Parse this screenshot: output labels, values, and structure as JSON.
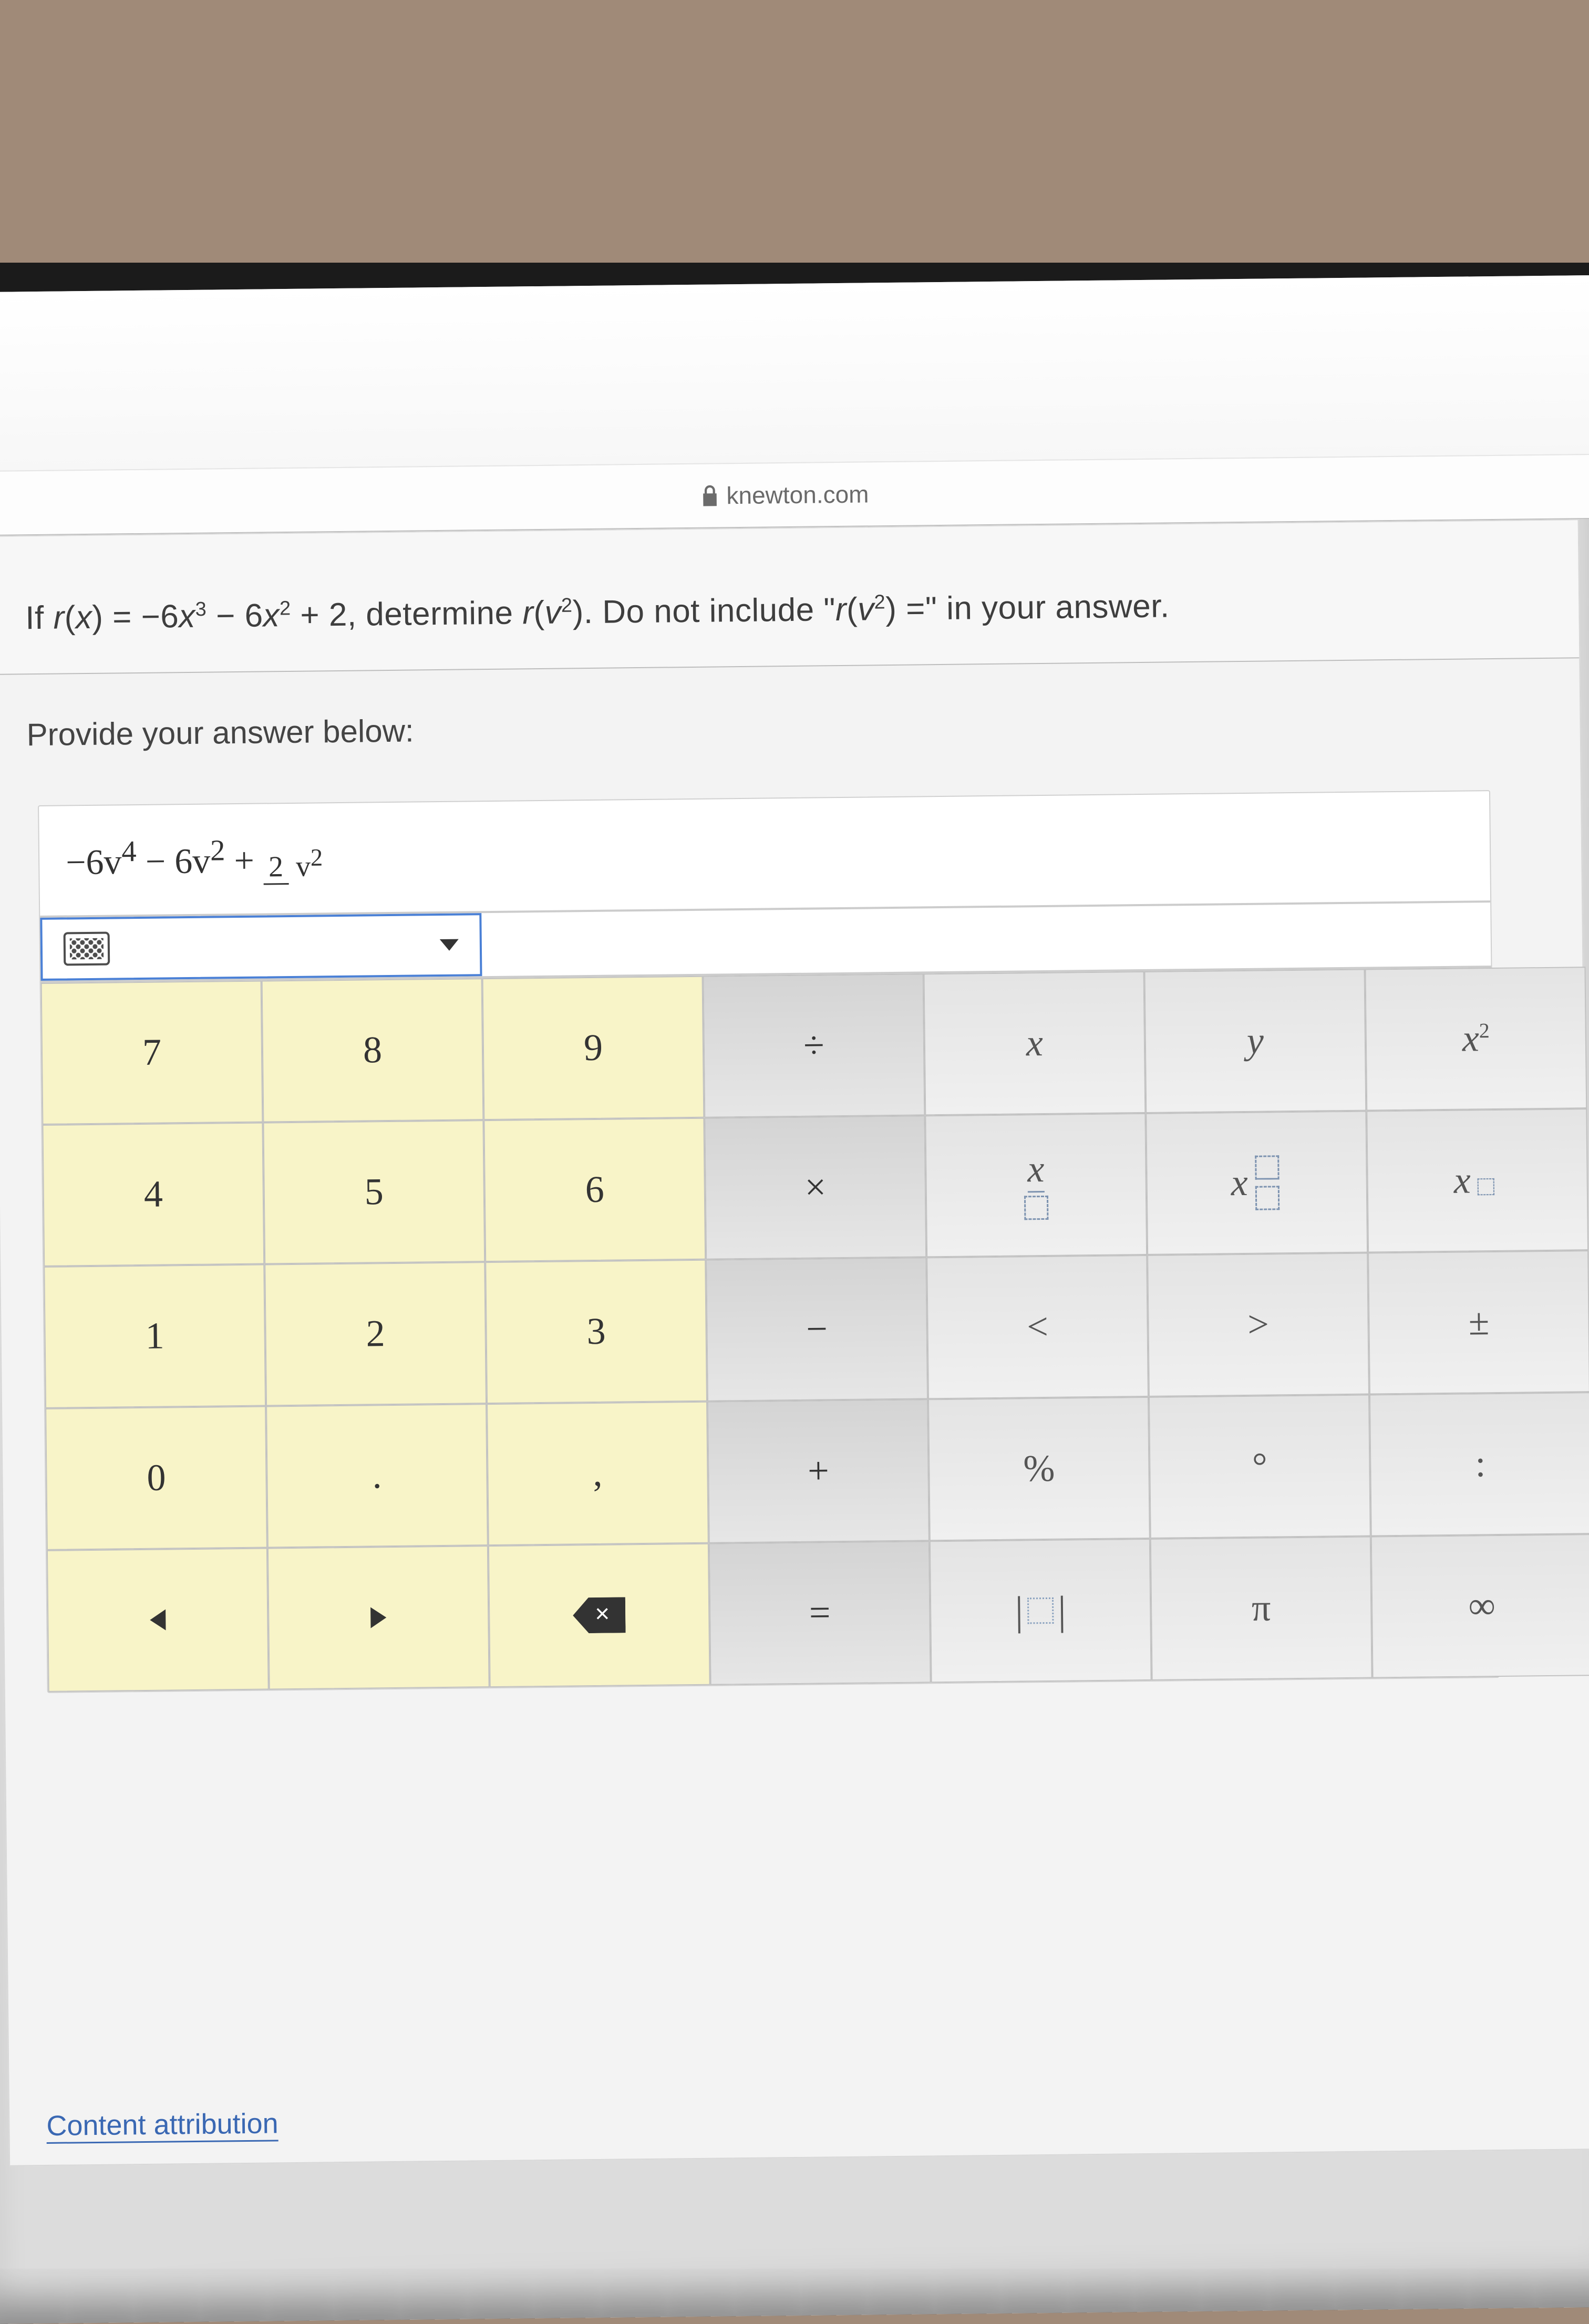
{
  "browser": {
    "domain": "knewton.com"
  },
  "question": {
    "text_html": "If r(x) = −6x³ − 6x² + 2, determine r(v²). Do not include \"r(v²) =\" in your answer."
  },
  "prompt": "Provide your answer below:",
  "answer_display": "−6v⁴ − 6v² + 2 / v²",
  "answer": {
    "t1": "−6v",
    "e1": "4",
    "t2": " − 6v",
    "e2": "2",
    "t3": " + ",
    "frac_num": "2",
    "frac_den_base": "v",
    "frac_den_exp": "2"
  },
  "keypad": {
    "numbers": [
      [
        "7",
        "8",
        "9"
      ],
      [
        "4",
        "5",
        "6"
      ],
      [
        "1",
        "2",
        "3"
      ],
      [
        "0",
        ".",
        ","
      ]
    ],
    "ops": [
      "÷",
      "×",
      "−",
      "+",
      "="
    ],
    "col5": [
      "x",
      "x / box",
      "<",
      "%",
      "|box|"
    ],
    "col6": [
      "y",
      "x box/box",
      ">",
      "°",
      "π"
    ],
    "col7": [
      "x²",
      "x_box",
      "±",
      ":",
      "∞"
    ]
  },
  "footer": {
    "attribution": "Content attribution"
  }
}
